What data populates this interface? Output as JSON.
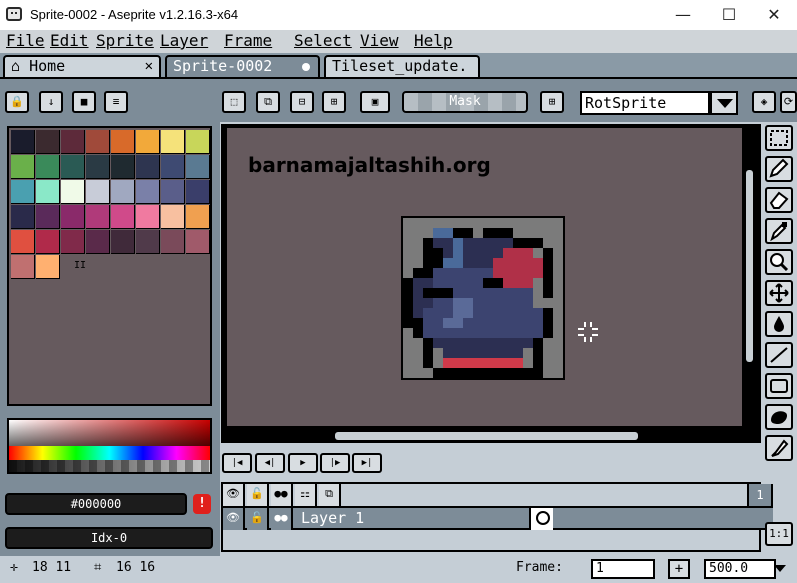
{
  "window": {
    "title": "Sprite-0002 - Aseprite v1.2.16.3-x64",
    "minimize": "—",
    "maximize": "☐",
    "close": "✕"
  },
  "menu": [
    "File",
    "Edit",
    "Sprite",
    "Layer",
    "Frame",
    "Select",
    "View",
    "Help"
  ],
  "tabs": [
    {
      "label": "Home",
      "close": "✕"
    },
    {
      "label": "Sprite-0002"
    },
    {
      "label": "Tileset_update."
    }
  ],
  "toolbar": {
    "mask_label": "Mask",
    "rotation_algorithm": "RotSprite"
  },
  "palette": {
    "colors": [
      "#1a1c2c",
      "#3b2a2f",
      "#5d2a3a",
      "#a04a3a",
      "#d86a2a",
      "#f2a93a",
      "#f5e27a",
      "#c8d65a",
      "#6ab04a",
      "#3a8a5a",
      "#2a5a54",
      "#2a3a44",
      "#1f2a30",
      "#2e3550",
      "#3e4a72",
      "#5a7a92",
      "#4aa0b0",
      "#8ae8c8",
      "#f0fae8",
      "#c8ccd8",
      "#a0a8c0",
      "#7a80a8",
      "#5a5e8a",
      "#3a3e6a",
      "#2a2a4a",
      "#5a2a5a",
      "#8a2a6a",
      "#b03a7a",
      "#d04a8a",
      "#f07aa0",
      "#f8c0a0",
      "#f0a050",
      "#e05040",
      "#b02a4a",
      "#802a4a",
      "#5a2a4a",
      "#402a3a",
      "#503a4a",
      "#7a4a5a",
      "#a05a6a",
      "#c07070",
      "#ffb070"
    ],
    "extra_glyph": "II"
  },
  "color_fields": {
    "hex": "#000000",
    "index": "Idx-0",
    "warning": "!"
  },
  "canvas": {
    "watermark": "barnamajaltashih.org",
    "background": "#665a5e"
  },
  "timeline": {
    "frame_number": "1",
    "layer_name": "Layer 1"
  },
  "statusbar": {
    "cursor": "18  11",
    "size": "16  16",
    "frame_label": "Frame:",
    "frame_value": "1",
    "plus": "+",
    "zoom": "500.0",
    "ratio": "1:1"
  }
}
